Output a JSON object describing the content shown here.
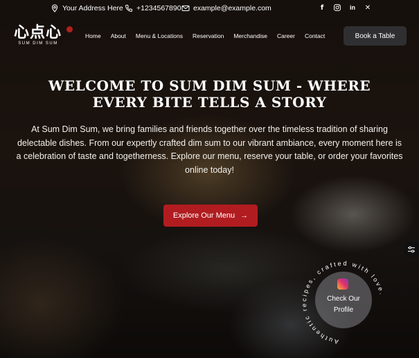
{
  "topbar": {
    "address": "Your Address Here",
    "phone": "+1234567890",
    "email": "example@example.com",
    "social_icons": [
      "facebook-icon",
      "instagram-icon",
      "linkedin-icon",
      "x-icon"
    ]
  },
  "logo": {
    "text": "心点心",
    "subtitle": "SUM DIM SUM"
  },
  "nav": {
    "items": [
      {
        "label": "Home"
      },
      {
        "label": "About"
      },
      {
        "label": "Menu & Locations"
      },
      {
        "label": "Reservation"
      },
      {
        "label": "Merchandise"
      },
      {
        "label": "Career"
      },
      {
        "label": "Contact"
      }
    ],
    "cta": "Book a Table"
  },
  "hero": {
    "title_line1": "Welcome to Sum Dim Sum - Where",
    "title_line2": "Every Bite Tells a Story",
    "body": "At Sum Dim Sum, we bring families and friends together over the timeless tradition of sharing delectable dishes. From our expertly crafted dim sum to our vibrant ambiance, every moment here is a celebration of taste and togetherness. Explore our menu, reserve your table, or order your favorites online today!",
    "button": "Explore Our Menu",
    "button_arrow": "→"
  },
  "badge": {
    "line1": "Check Our",
    "line2": "Profile",
    "ring_text": "Authentic recipes, crafted with love."
  },
  "colors": {
    "accent": "#b11c20",
    "dark_button": "#2f2f31"
  }
}
